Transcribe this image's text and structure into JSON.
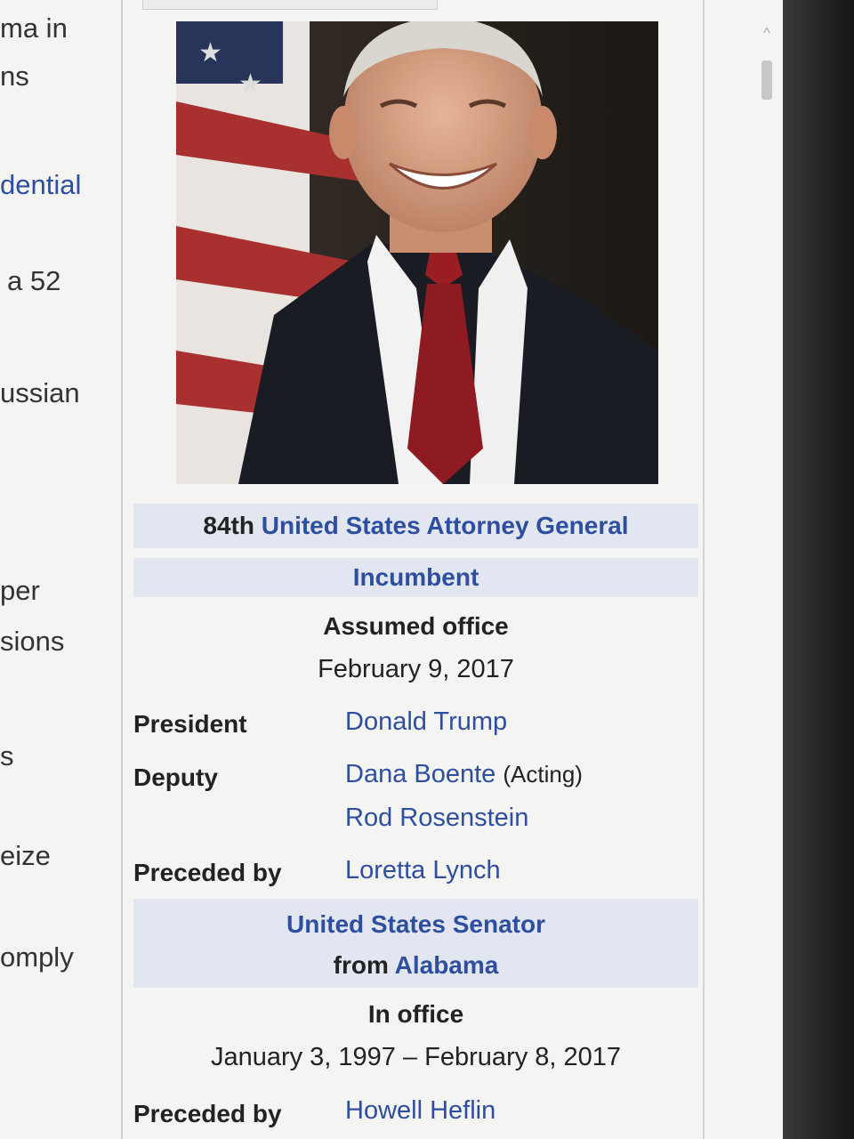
{
  "left_column_fragments": [
    {
      "text": "ma in",
      "link": false
    },
    {
      "text": "ns",
      "link": false
    },
    {
      "text": "dential",
      "link": true
    },
    {
      "text": "a 52",
      "link": false
    },
    {
      "text": "ussian",
      "link": false
    },
    {
      "text": "per",
      "link": false
    },
    {
      "text": "sions",
      "link": false
    },
    {
      "text": "s",
      "link": false
    },
    {
      "text": "eize",
      "link": false
    },
    {
      "text": "omply",
      "link": false
    }
  ],
  "infobox": {
    "office_ordinal": "84th",
    "office_title": "United States Attorney General",
    "status": "Incumbent",
    "assumed_label": "Assumed office",
    "assumed_date": "February 9, 2017",
    "president_label": "President",
    "president": "Donald Trump",
    "deputy_label": "Deputy",
    "deputy_1": "Dana Boente",
    "deputy_1_note": "(Acting)",
    "deputy_2": "Rod Rosenstein",
    "preceded_label": "Preceded by",
    "preceded": "Loretta Lynch",
    "senate_title": "United States Senator",
    "senate_from": "from",
    "senate_state": "Alabama",
    "in_office_label": "In office",
    "in_office_dates": "January 3, 1997 – February 8, 2017",
    "senate_preceded_label": "Preceded by",
    "senate_preceded": "Howell Heflin"
  },
  "colors": {
    "link": "#2e4ea0",
    "header_band": "#e2e6f0"
  }
}
